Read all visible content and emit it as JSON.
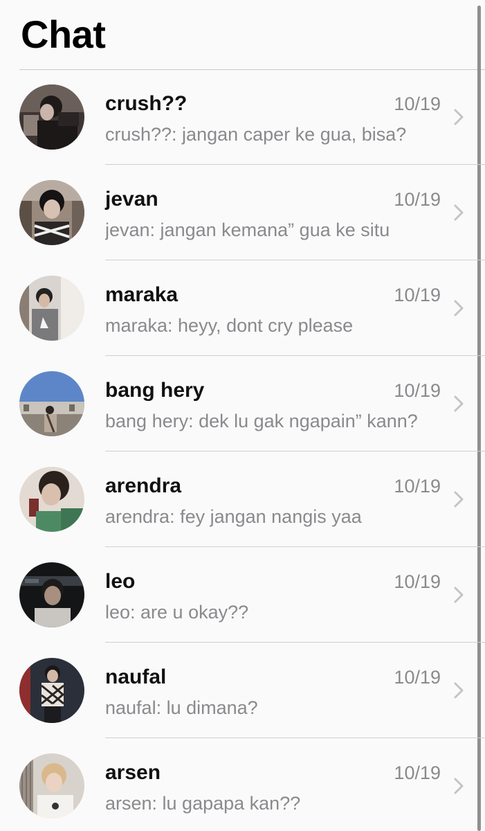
{
  "header": {
    "title": "Chat"
  },
  "chats": [
    {
      "name": "crush??",
      "date": "10/19",
      "preview": "crush??: jangan caper ke gua, bisa?",
      "avatar_icon": "profile-photo"
    },
    {
      "name": "jevan",
      "date": "10/19",
      "preview": "jevan: jangan kemana” gua ke situ",
      "avatar_icon": "profile-photo"
    },
    {
      "name": "maraka",
      "date": "10/19",
      "preview": "maraka: heyy, dont cry please",
      "avatar_icon": "profile-photo"
    },
    {
      "name": "bang hery",
      "date": "10/19",
      "preview": "bang hery: dek lu gak ngapain” kann?",
      "avatar_icon": "profile-photo"
    },
    {
      "name": "arendra",
      "date": "10/19",
      "preview": "arendra: fey jangan nangis yaa",
      "avatar_icon": "profile-photo"
    },
    {
      "name": "leo",
      "date": "10/19",
      "preview": "leo: are u okay??",
      "avatar_icon": "profile-photo"
    },
    {
      "name": "naufal",
      "date": "10/19",
      "preview": "naufal: lu dimana?",
      "avatar_icon": "profile-photo"
    },
    {
      "name": "arsen",
      "date": "10/19",
      "preview": "arsen: lu gapapa kan??",
      "avatar_icon": "profile-photo"
    }
  ],
  "colors": {
    "background": "#fafafa",
    "name_text": "#111111",
    "secondary_text": "#8a8a8e",
    "divider": "#cfcfcf",
    "chevron": "#c4c4c6"
  }
}
